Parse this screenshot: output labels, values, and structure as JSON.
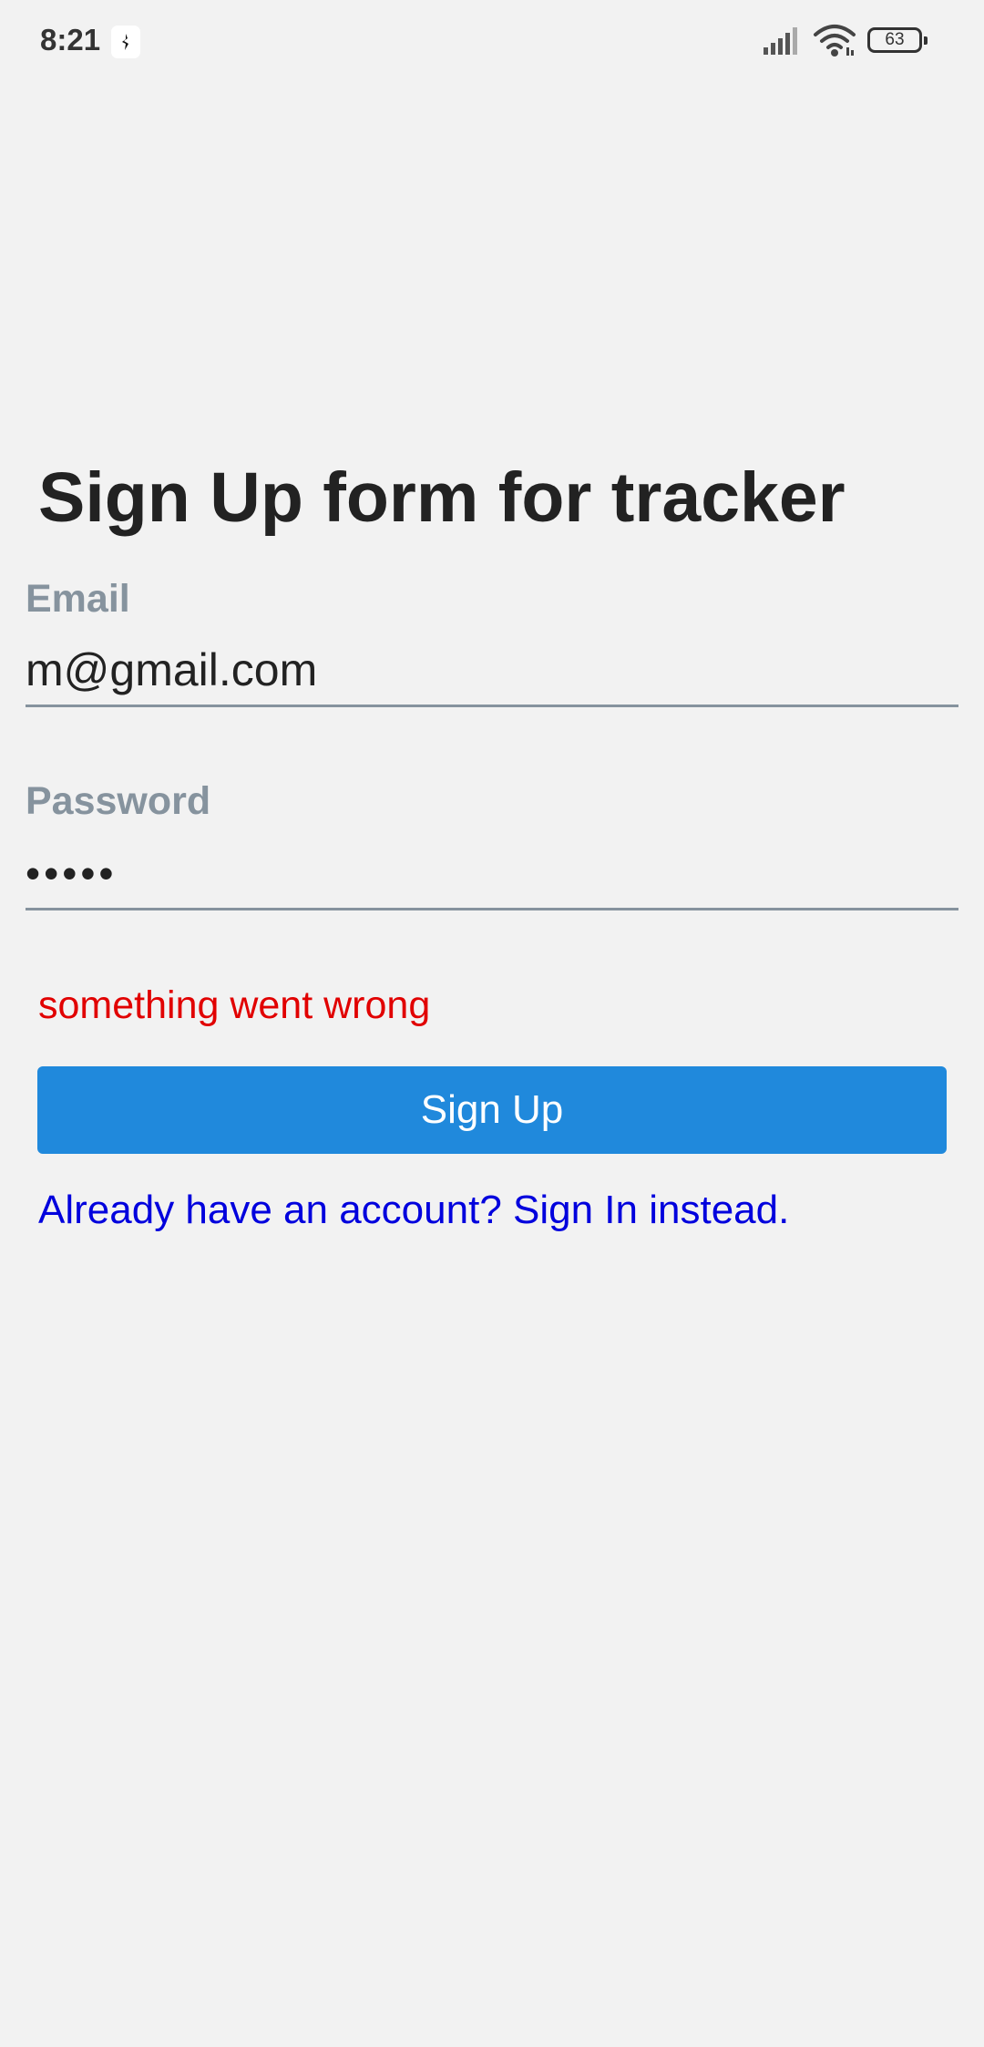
{
  "status_bar": {
    "time": "8:21",
    "battery_level": "63",
    "icons": [
      "app-notification-icon",
      "signal-icon",
      "wifi-icon",
      "battery-icon"
    ]
  },
  "form": {
    "title": "Sign Up form for tracker",
    "email": {
      "label": "Email",
      "value": "m@gmail.com"
    },
    "password": {
      "label": "Password",
      "value": "•••••"
    },
    "error_message": "something went wrong",
    "submit_label": "Sign Up",
    "signin_link": "Already have an account? Sign In instead."
  },
  "colors": {
    "background": "#f2f2f2",
    "primary_button": "#2089dc",
    "error": "#e10000",
    "link": "#0000dd",
    "label": "#86939e"
  }
}
